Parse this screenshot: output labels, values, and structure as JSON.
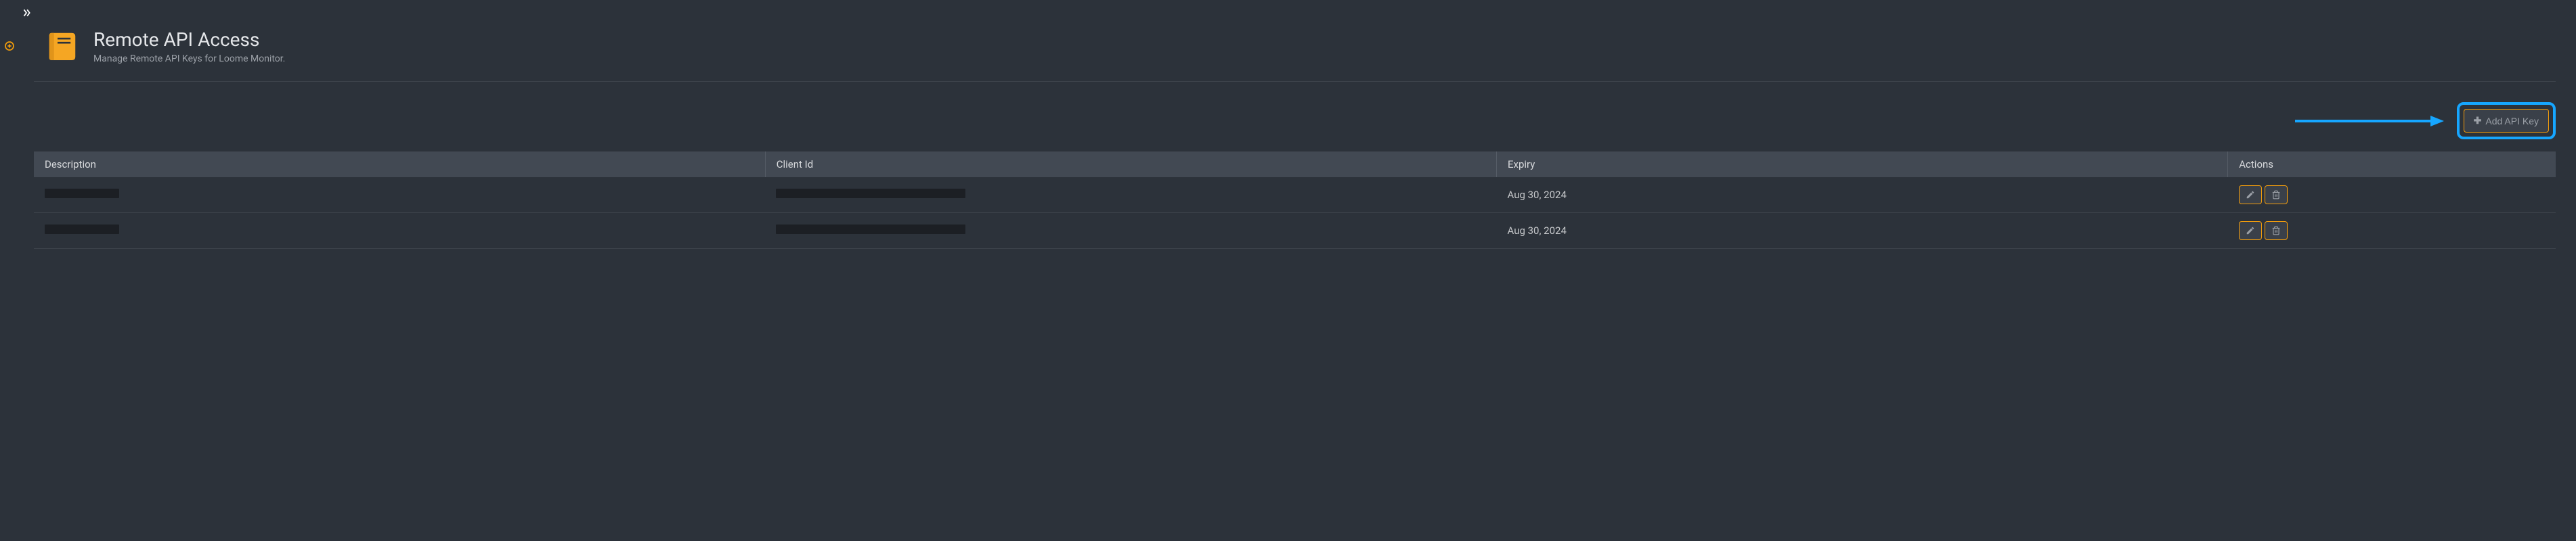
{
  "header": {
    "title": "Remote API Access",
    "subtitle": "Manage Remote API Keys for Loome Monitor."
  },
  "toolbar": {
    "add_label": "Add API Key"
  },
  "table": {
    "columns": {
      "description": "Description",
      "client_id": "Client Id",
      "expiry": "Expiry",
      "actions": "Actions"
    },
    "rows": [
      {
        "description": "",
        "client_id": "",
        "expiry": "Aug 30, 2024"
      },
      {
        "description": "",
        "client_id": "",
        "expiry": "Aug 30, 2024"
      }
    ]
  }
}
